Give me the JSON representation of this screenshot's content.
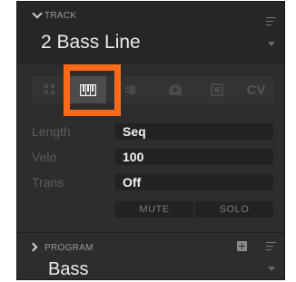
{
  "track": {
    "section_label": "TRACK",
    "name": "2 Bass Line",
    "menu_icon": "menu-lines-icon",
    "dropdown_icon": "triangle-down-icon",
    "collapse_icon": "chevron-down-icon"
  },
  "icon_bar": {
    "items": [
      {
        "name": "grid-pads-icon",
        "active": false
      },
      {
        "name": "piano-keys-icon",
        "active": true
      },
      {
        "name": "midi-plug-icon",
        "active": false
      },
      {
        "name": "controller-icon",
        "active": false
      },
      {
        "name": "square-icon",
        "active": false
      },
      {
        "name": "cv-icon",
        "label": "CV",
        "active": false
      }
    ],
    "highlight_color": "#ff6a1a"
  },
  "params": {
    "length": {
      "label": "Length",
      "value": "Seq"
    },
    "velo": {
      "label": "Velo",
      "value": "100"
    },
    "trans": {
      "label": "Trans",
      "value": "Off"
    },
    "mute_label": "MUTE",
    "solo_label": "SOLO"
  },
  "program": {
    "section_label": "PROGRAM",
    "name": "Bass",
    "expand_icon": "chevron-right-icon",
    "add_icon": "plus-icon",
    "menu_icon": "menu-lines-icon",
    "dropdown_icon": "triangle-down-icon"
  }
}
